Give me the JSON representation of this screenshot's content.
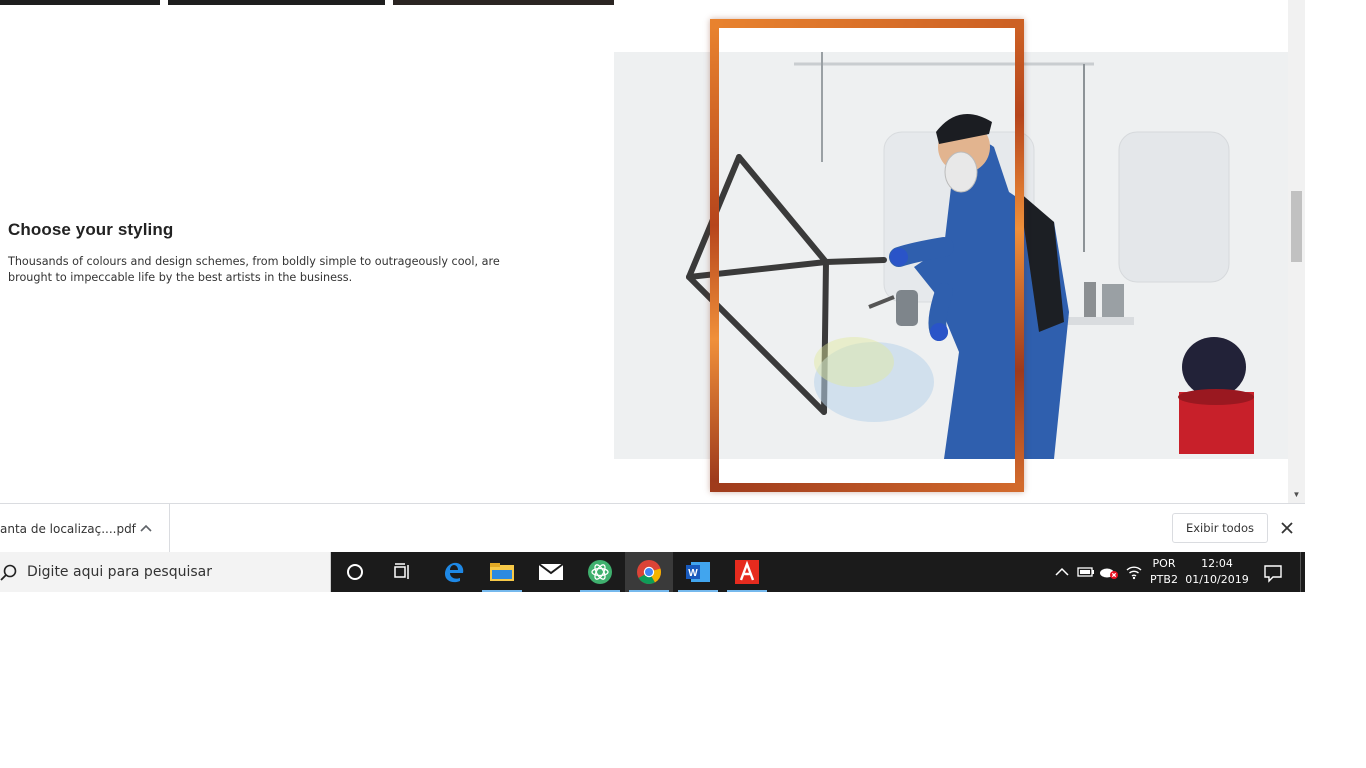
{
  "page": {
    "feature_title": "Choose your styling",
    "feature_desc": "Thousands of colours and design schemes, from boldly simple to outrageously cool, are brought to impeccable life by the best artists in the business."
  },
  "downloads": {
    "file_name": "anta de localizaç....pdf",
    "show_all_label": "Exibir todos",
    "close_icon": "close-icon"
  },
  "taskbar": {
    "search_placeholder": "Digite aqui para pesquisar",
    "apps": [
      "cortana",
      "task-view",
      "edge",
      "file-explorer",
      "mail",
      "atom-app",
      "chrome",
      "word",
      "acrobat"
    ],
    "tray": {
      "lang_line1": "POR",
      "lang_line2": "PTB2",
      "time": "12:04",
      "date": "01/10/2019"
    }
  },
  "colors": {
    "frame_accent": "#c85a22",
    "taskbar_bg": "#1b1b1b",
    "running_indicator": "#76b9ed"
  }
}
